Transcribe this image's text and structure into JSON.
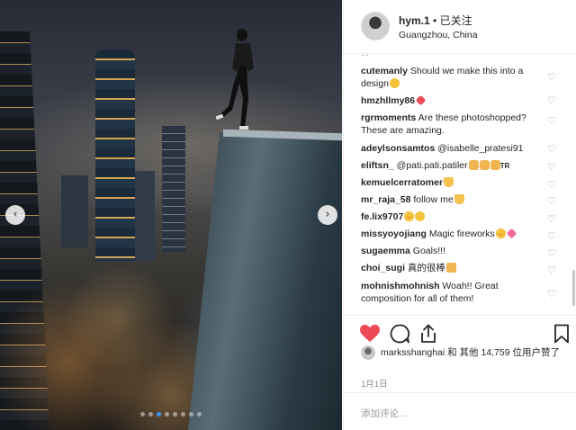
{
  "post": {
    "photo_alt": "Person standing on the edge of a skyscraper above a night city",
    "carousel_prev_icon": "chevron-left-icon",
    "carousel_next_icon": "chevron-right-icon",
    "carousel_pages": 8,
    "carousel_current": 3
  },
  "header": {
    "username": "hym.1",
    "separator": " • ",
    "follow_status": "已关注",
    "location": "Guangzhou, China"
  },
  "comments": {
    "cut_off_text": "...",
    "items": [
      {
        "user": "cutemanly",
        "text": "Should we make this into a design",
        "emoji": [
          "thinking-face"
        ]
      },
      {
        "user": "hmzhllmy86",
        "text": "",
        "emoji": [
          "red-heart"
        ]
      },
      {
        "user": "rgrmoments",
        "text": "Are these photoshopped? These are amazing.",
        "emoji": []
      },
      {
        "user": "adeylsonsamtos",
        "text": "@isabelle_pratesi91",
        "emoji": []
      },
      {
        "user": "eliftsn_",
        "text": "@pati.pati.patiler",
        "emoji": [
          "hand",
          "hand",
          "hand"
        ],
        "suffix": "TR"
      },
      {
        "user": "kemuelcerratomer",
        "text": "",
        "emoji": [
          "praying-hands"
        ]
      },
      {
        "user": "mr_raja_58",
        "text": "follow me",
        "emoji": [
          "praying-hands"
        ]
      },
      {
        "user": "fe.lix9707",
        "text": "",
        "emoji": [
          "heart-eyes",
          "astonished"
        ]
      },
      {
        "user": "missyoyojiang",
        "text": "Magic fireworks",
        "emoji": [
          "heart-eyes",
          "pink-heart"
        ]
      },
      {
        "user": "sugaemma",
        "text": "Goals!!!",
        "emoji": []
      },
      {
        "user": "choi_sugi",
        "text": "真的很棒",
        "emoji": [
          "flexed-biceps"
        ]
      },
      {
        "user": "mohnishmohnish",
        "text": "Woah!! Great composition for all of them!",
        "emoji": []
      }
    ]
  },
  "actions": {
    "like_icon": "heart-filled-icon",
    "comment_icon": "comment-bubble-icon",
    "share_icon": "share-icon",
    "save_icon": "bookmark-icon",
    "like_color": "#ed4956"
  },
  "likes": {
    "text": "marksshanghai 和 其他 14,759 位用户赞了",
    "user": "marksshanghai",
    "rest": " 和 其他 14,759 位用户赞了"
  },
  "date": "1月1日",
  "add_comment": {
    "placeholder": "添加评论..."
  }
}
